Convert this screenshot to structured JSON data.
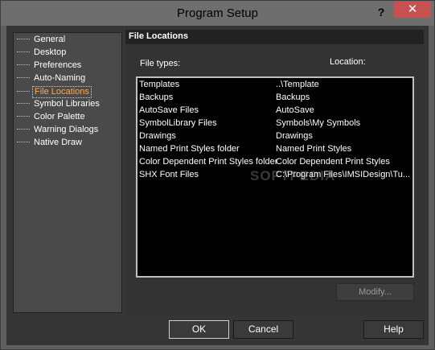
{
  "window": {
    "title": "Program Setup",
    "help_glyph": "?",
    "close_glyph": "✕"
  },
  "tree": {
    "items": [
      {
        "label": "General",
        "selected": false
      },
      {
        "label": "Desktop",
        "selected": false
      },
      {
        "label": "Preferences",
        "selected": false
      },
      {
        "label": "Auto-Naming",
        "selected": false
      },
      {
        "label": "File Locations",
        "selected": true
      },
      {
        "label": "Symbol Libraries",
        "selected": false
      },
      {
        "label": "Color Palette",
        "selected": false
      },
      {
        "label": "Warning Dialogs",
        "selected": false
      },
      {
        "label": "Native Draw",
        "selected": false
      }
    ]
  },
  "panel": {
    "title": "File Locations",
    "file_types_label": "File types:",
    "location_label": "Location:",
    "rows": [
      {
        "type": "Templates",
        "location": "..\\Template"
      },
      {
        "type": "Backups",
        "location": "Backups"
      },
      {
        "type": "AutoSave Files",
        "location": "AutoSave"
      },
      {
        "type": "SymbolLibrary Files",
        "location": "Symbols\\My Symbols"
      },
      {
        "type": "Drawings",
        "location": "Drawings"
      },
      {
        "type": "Named Print Styles folder",
        "location": "Named Print Styles"
      },
      {
        "type": "Color Dependent Print Styles folder",
        "location": "Color Dependent Print Styles"
      },
      {
        "type": "SHX Font Files",
        "location": "C:\\Program Files\\IMSIDesign\\Tu..."
      }
    ],
    "watermark": "SOFTPEDIA",
    "modify_label": "Modify..."
  },
  "buttons": {
    "ok": "OK",
    "cancel": "Cancel",
    "help": "Help"
  }
}
